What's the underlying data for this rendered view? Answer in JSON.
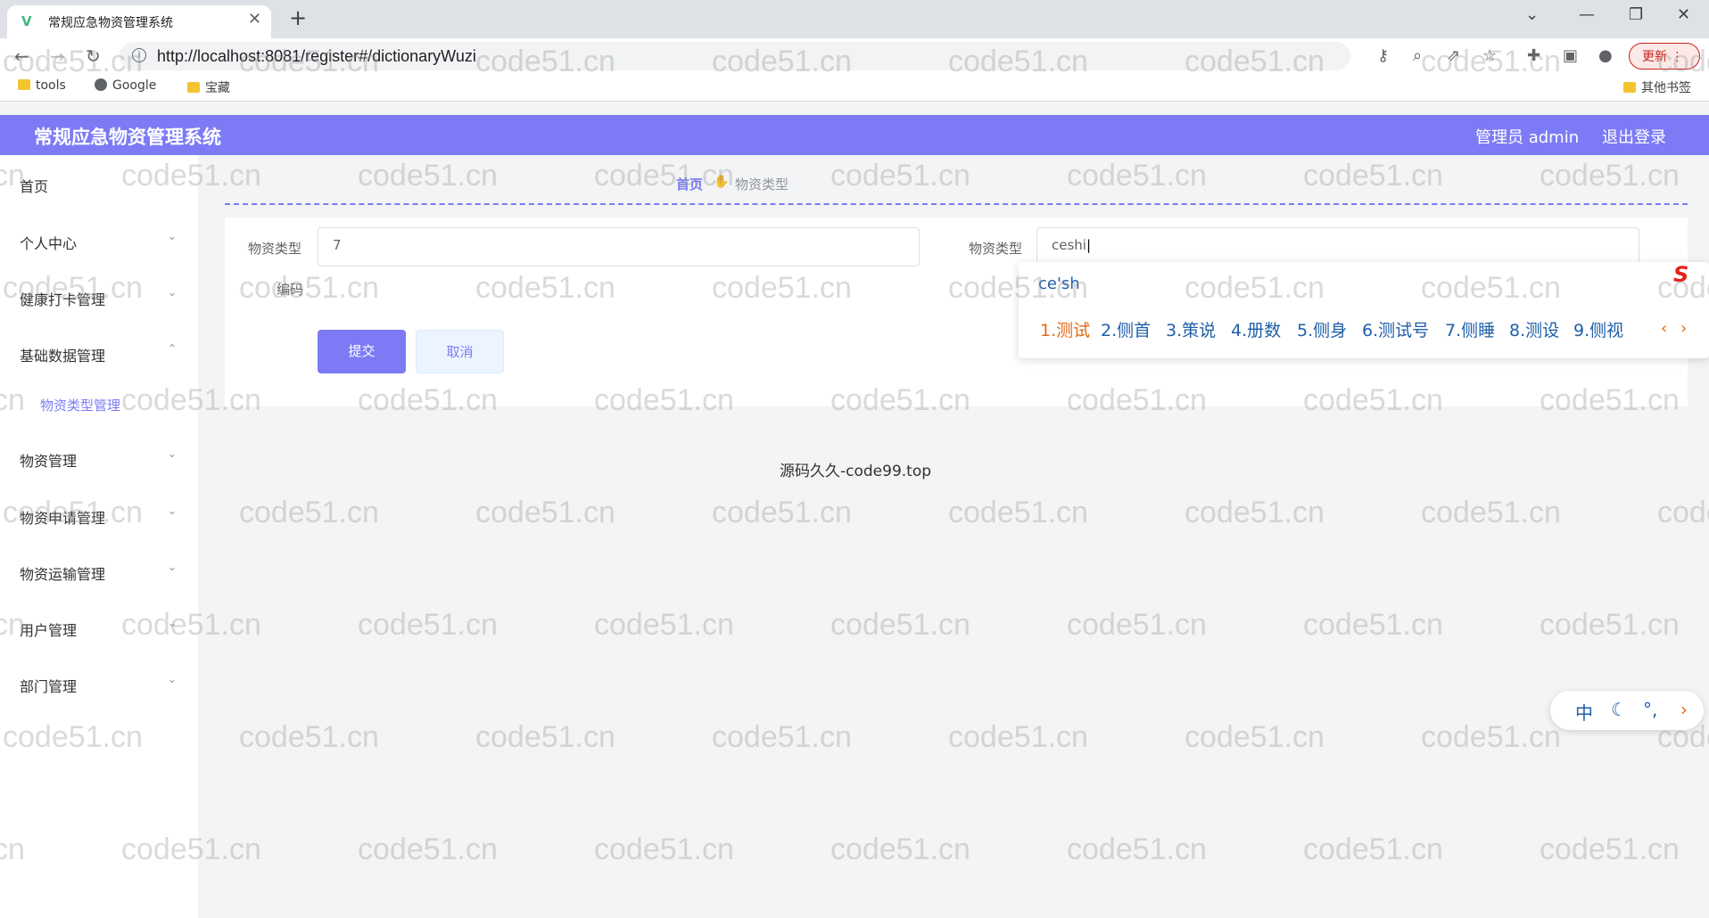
{
  "browser": {
    "tab_title": "常规应急物资管理系统",
    "tab_close": "✕",
    "new_tab": "+",
    "url": "http://localhost:8081/register#/dictionaryWuzi",
    "update_label": "更新",
    "bookmarks": [
      {
        "label": "tools",
        "icon": "folder-icon"
      },
      {
        "label": "Google",
        "icon": "globe-icon"
      },
      {
        "label": "宝藏",
        "icon": "folder-icon"
      }
    ],
    "other_bookmarks": "其他书签"
  },
  "header": {
    "title": "常规应急物资管理系统",
    "admin": "管理员 admin",
    "logout": "退出登录",
    "color": "#7c7bf5"
  },
  "sidebar": {
    "items": [
      {
        "label": "首页"
      },
      {
        "label": "个人中心"
      },
      {
        "label": "健康打卡管理"
      },
      {
        "label": "基础数据管理"
      },
      {
        "label": "物资类型管理"
      },
      {
        "label": "物资管理"
      },
      {
        "label": "物资申请管理"
      },
      {
        "label": "物资运输管理"
      },
      {
        "label": "用户管理"
      },
      {
        "label": "部门管理"
      }
    ]
  },
  "breadcrumb": {
    "home": "首页",
    "current": "物资类型"
  },
  "form": {
    "field1_label": "物资类型",
    "field1_value": "7",
    "field2_label": "物资类型",
    "field2_value": "ceshi",
    "code_label": "编码",
    "submit": "提交",
    "cancel": "取消"
  },
  "footer": {
    "text": "源码久久-code99.top"
  },
  "ime": {
    "pinyin": "ce'sh",
    "candidates": [
      "1.测试",
      "2.侧首",
      "3.策说",
      "4.册数",
      "5.侧身",
      "6.测试号",
      "7.侧睡",
      "8.测设",
      "9.侧视"
    ],
    "prev": "‹",
    "next": "›",
    "toolbar_lang": "中",
    "toolbar_moon": "☾",
    "toolbar_punct": "°,",
    "toolbar_arrow": "›"
  },
  "watermark": "code51.cn"
}
